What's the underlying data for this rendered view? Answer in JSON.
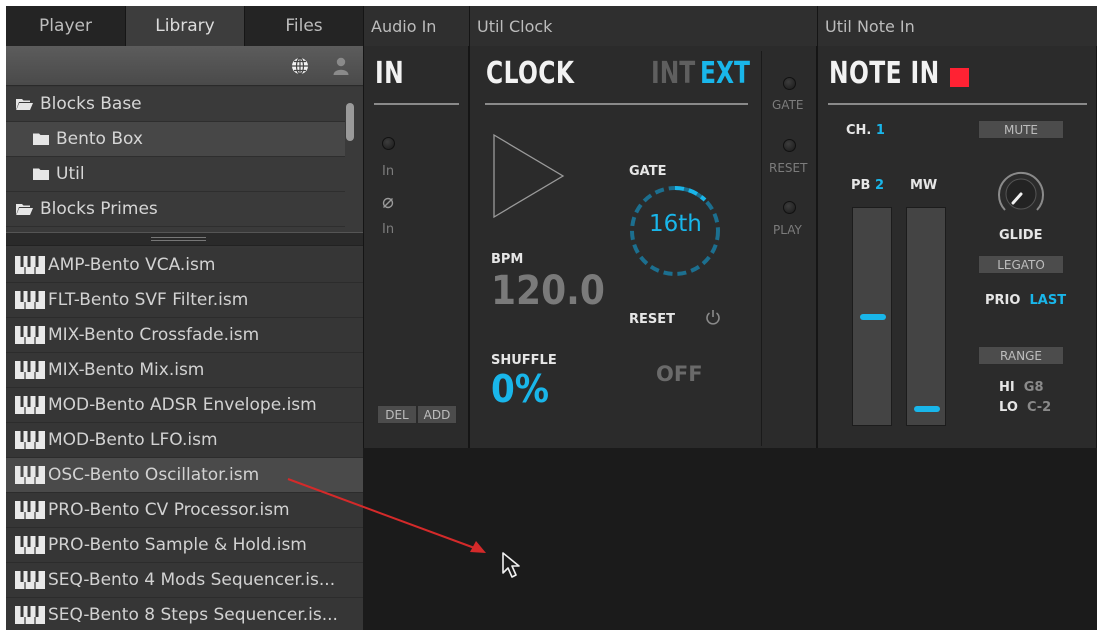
{
  "browser": {
    "tabs": [
      {
        "label": "Player"
      },
      {
        "label": "Library"
      },
      {
        "label": "Files"
      }
    ],
    "toolbar": {
      "globe_icon": "globe-icon",
      "user_icon": "user-icon"
    },
    "folders": [
      {
        "label": "Blocks Base"
      },
      {
        "label": "Bento Box"
      },
      {
        "label": "Util"
      },
      {
        "label": "Blocks Primes"
      }
    ],
    "files": [
      {
        "label": "AMP-Bento VCA.ism"
      },
      {
        "label": "FLT-Bento SVF Filter.ism"
      },
      {
        "label": "MIX-Bento Crossfade.ism"
      },
      {
        "label": "MIX-Bento Mix.ism"
      },
      {
        "label": "MOD-Bento ADSR Envelope.ism"
      },
      {
        "label": "MOD-Bento LFO.ism"
      },
      {
        "label": "OSC-Bento Oscillator.ism"
      },
      {
        "label": "PRO-Bento CV Processor.ism"
      },
      {
        "label": "PRO-Bento Sample & Hold.ism"
      },
      {
        "label": "SEQ-Bento 4 Mods Sequencer.is..."
      },
      {
        "label": "SEQ-Bento 8 Steps Sequencer.is..."
      }
    ]
  },
  "modules": {
    "audio_in": {
      "header": "Audio In",
      "title": "IN",
      "in1": "In",
      "in2": "In",
      "del": "DEL",
      "add": "ADD"
    },
    "util_clock": {
      "header": "Util Clock",
      "title": "CLOCK",
      "int": "INT",
      "ext": "EXT",
      "gate_label": "GATE",
      "gate_value": "16th",
      "bpm_label": "BPM",
      "bpm_value": "120.0",
      "reset_label": "RESET",
      "reset_value": "OFF",
      "shuffle_label": "SHUFFLE",
      "shuffle_value": "0%",
      "out_gate": "GATE",
      "out_reset": "RESET",
      "out_play": "PLAY"
    },
    "util_note_in": {
      "header": "Util Note In",
      "title": "NOTE IN",
      "ch_label": "CH.",
      "ch_value": "1",
      "mute": "MUTE",
      "pb_label": "PB",
      "pb_value": "2",
      "mw_label": "MW",
      "pb_level": 0.5,
      "mw_level": 0.05,
      "glide": "GLIDE",
      "legato": "LEGATO",
      "prio_label": "PRIO",
      "prio_value": "LAST",
      "range": "RANGE",
      "hi_label": "HI",
      "hi_value": "G8",
      "lo_label": "LO",
      "lo_value": "C-2"
    }
  },
  "colors": {
    "accent": "#19b6ea",
    "record": "#ff2233",
    "arrow": "#d42a2a"
  }
}
